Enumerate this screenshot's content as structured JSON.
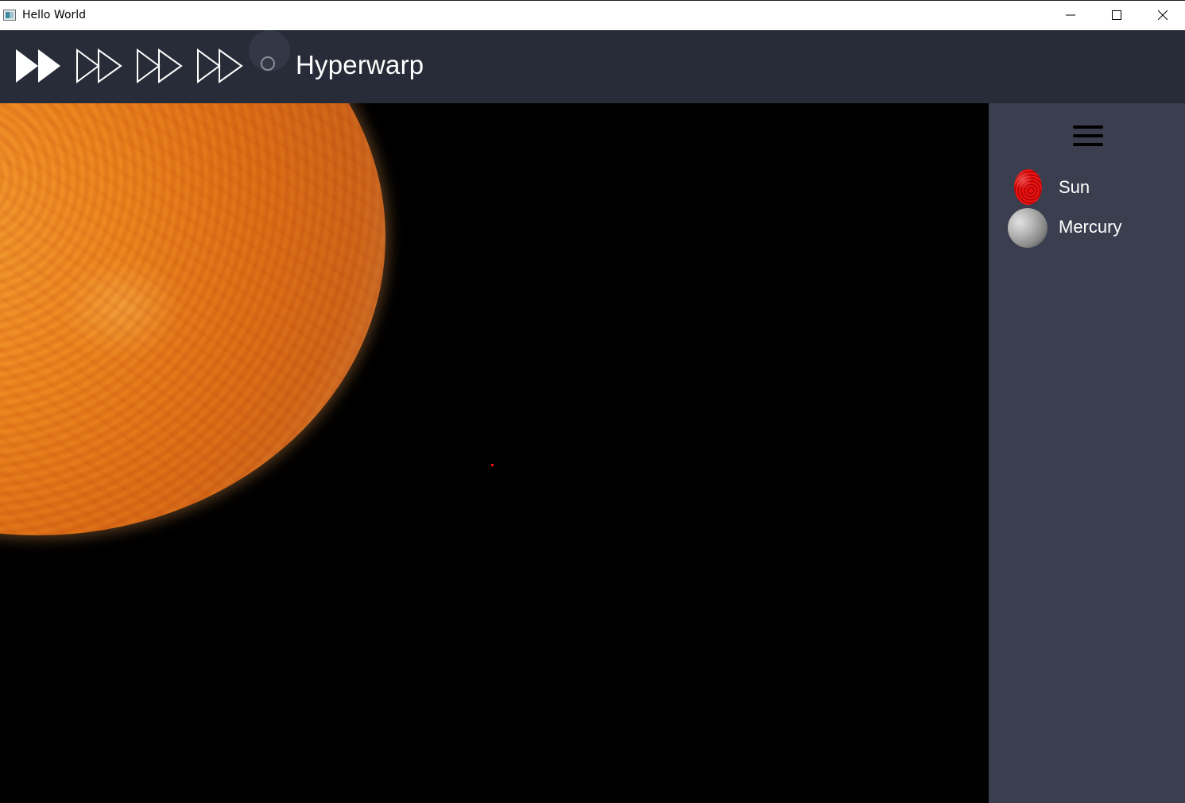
{
  "window": {
    "title": "Hello World"
  },
  "toolbar": {
    "speed_buttons": [
      "speed-1x",
      "speed-2x",
      "speed-3x",
      "speed-4x"
    ],
    "hyperwarp_label": "Hyperwarp"
  },
  "sidebar": {
    "menu_icon": "hamburger-menu-icon",
    "planets": [
      {
        "name": "Sun",
        "color": "#d00000"
      },
      {
        "name": "Mercury",
        "color": "#9a9a9a"
      }
    ]
  },
  "colors": {
    "toolbar_bg": "#282c38",
    "sidebar_bg": "#3a3e4e",
    "viewport_bg": "#000000",
    "marker": "#ff1010"
  }
}
